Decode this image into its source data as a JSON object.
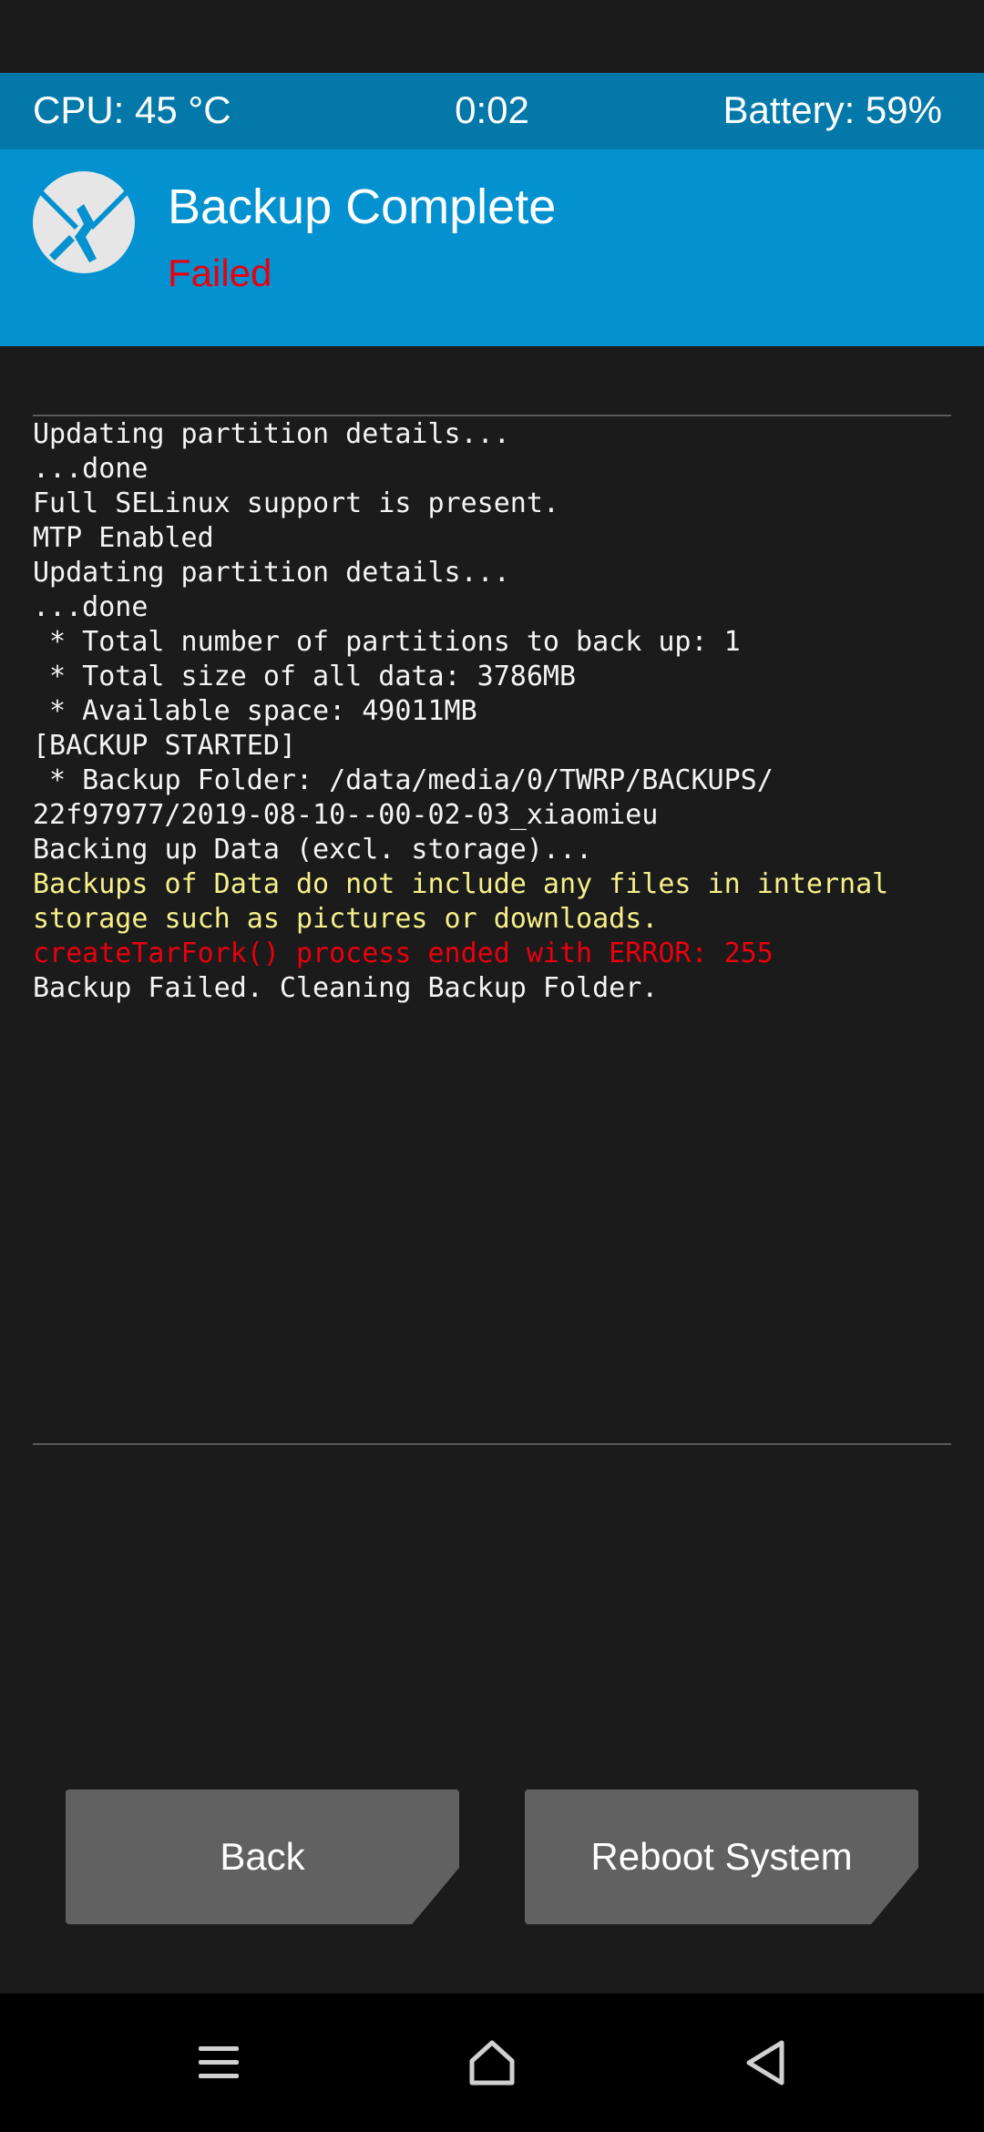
{
  "status_bar": {
    "cpu": "CPU: 45 °C",
    "time": "0:02",
    "battery": "Battery: 59%"
  },
  "header": {
    "title": "Backup Complete",
    "subtitle": "Failed",
    "logo_icon": "twrp-logo-icon"
  },
  "console": {
    "lines": [
      {
        "text": "Updating partition details...",
        "level": "normal"
      },
      {
        "text": "...done",
        "level": "normal"
      },
      {
        "text": "Full SELinux support is present.",
        "level": "normal"
      },
      {
        "text": "MTP Enabled",
        "level": "normal"
      },
      {
        "text": "Updating partition details...",
        "level": "normal"
      },
      {
        "text": "...done",
        "level": "normal"
      },
      {
        "text": " * Total number of partitions to back up: 1",
        "level": "normal"
      },
      {
        "text": " * Total size of all data: 3786MB",
        "level": "normal"
      },
      {
        "text": " * Available space: 49011MB",
        "level": "normal"
      },
      {
        "text": "[BACKUP STARTED]",
        "level": "normal"
      },
      {
        "text": " * Backup Folder: /data/media/0/TWRP/BACKUPS/",
        "level": "normal"
      },
      {
        "text": "22f97977/2019-08-10--00-02-03_xiaomieu",
        "level": "normal"
      },
      {
        "text": "Backing up Data (excl. storage)...",
        "level": "normal"
      },
      {
        "text": "Backups of Data do not include any files in internal",
        "level": "warn"
      },
      {
        "text": "storage such as pictures or downloads.",
        "level": "warn"
      },
      {
        "text": "createTarFork() process ended with ERROR: 255",
        "level": "err"
      },
      {
        "text": "Backup Failed. Cleaning Backup Folder.",
        "level": "normal"
      }
    ]
  },
  "buttons": {
    "back": "Back",
    "reboot": "Reboot System"
  },
  "navbar": {
    "menu_icon": "menu-icon",
    "home_icon": "home-icon",
    "back_icon": "back-triangle-icon"
  },
  "colors": {
    "status_bar_bg": "#0479a9",
    "header_bg": "#0392cf",
    "failed_text": "#e8000f",
    "warning_text": "#f5f08a",
    "background": "#1b1b1b",
    "button_bg": "#616161"
  }
}
